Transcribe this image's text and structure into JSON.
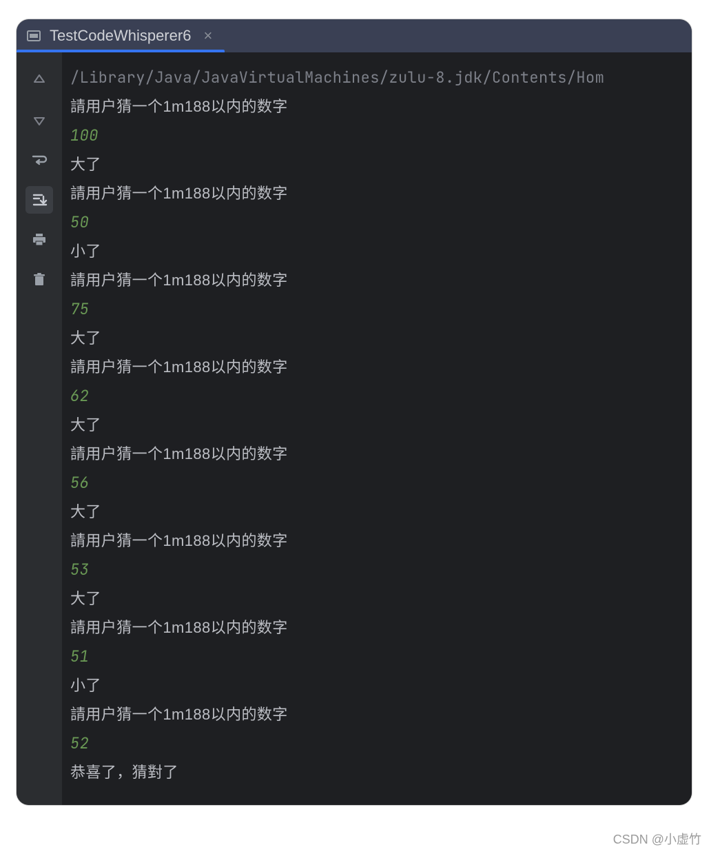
{
  "tab": {
    "label": "TestCodeWhisperer6",
    "close_glyph": "×"
  },
  "console": {
    "path": "/Library/Java/JavaVirtualMachines/zulu-8.jdk/Contents/Hom",
    "lines": [
      {
        "kind": "prompt",
        "text": "請用户猜一个1m188以内的数字"
      },
      {
        "kind": "input",
        "text": "100"
      },
      {
        "kind": "prompt",
        "text": "大了"
      },
      {
        "kind": "prompt",
        "text": "請用户猜一个1m188以内的数字"
      },
      {
        "kind": "input",
        "text": "50"
      },
      {
        "kind": "prompt",
        "text": "小了"
      },
      {
        "kind": "prompt",
        "text": "請用户猜一个1m188以内的数字"
      },
      {
        "kind": "input",
        "text": "75"
      },
      {
        "kind": "prompt",
        "text": "大了"
      },
      {
        "kind": "prompt",
        "text": "請用户猜一个1m188以内的数字"
      },
      {
        "kind": "input",
        "text": "62"
      },
      {
        "kind": "prompt",
        "text": "大了"
      },
      {
        "kind": "prompt",
        "text": "請用户猜一个1m188以内的数字"
      },
      {
        "kind": "input",
        "text": "56"
      },
      {
        "kind": "prompt",
        "text": "大了"
      },
      {
        "kind": "prompt",
        "text": "請用户猜一个1m188以内的数字"
      },
      {
        "kind": "input",
        "text": "53"
      },
      {
        "kind": "prompt",
        "text": "大了"
      },
      {
        "kind": "prompt",
        "text": "請用户猜一个1m188以内的数字"
      },
      {
        "kind": "input",
        "text": "51"
      },
      {
        "kind": "prompt",
        "text": "小了"
      },
      {
        "kind": "prompt",
        "text": "請用户猜一个1m188以内的数字"
      },
      {
        "kind": "input",
        "text": "52"
      },
      {
        "kind": "prompt",
        "text": "恭喜了，猜對了"
      }
    ]
  },
  "watermark": "CSDN @小虚竹"
}
